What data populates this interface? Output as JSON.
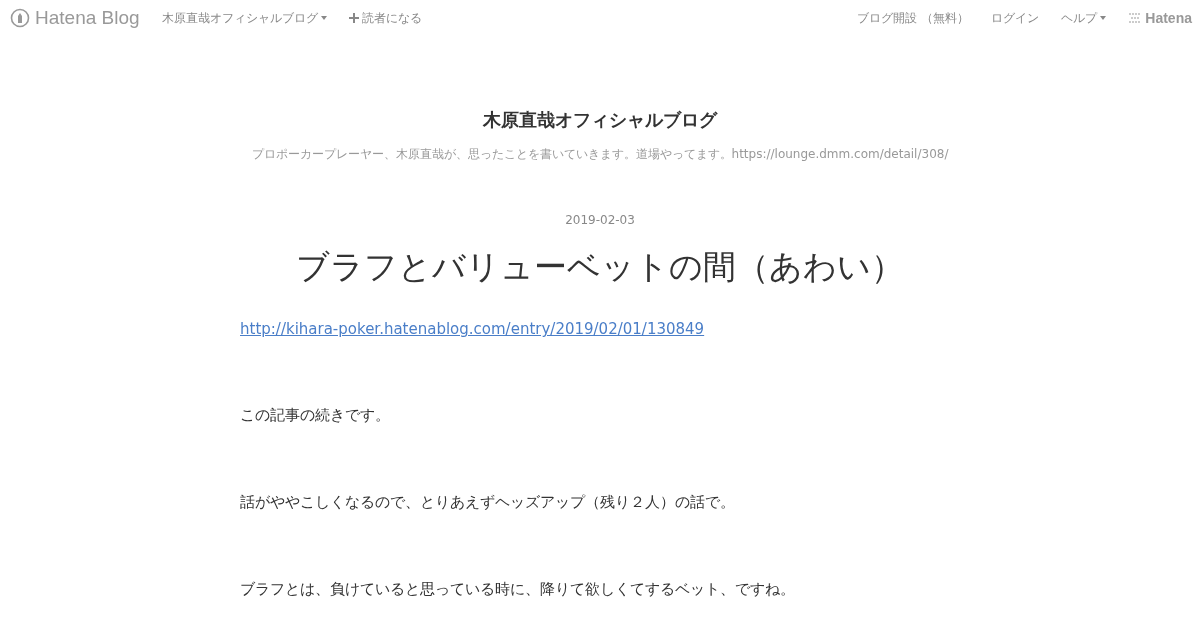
{
  "top_bar": {
    "logo": "Hatena Blog",
    "left_menu": [
      {
        "label": "木原直哉オフィシャルブログ",
        "kind": "dropdown"
      },
      {
        "label": "読者になる",
        "kind": "subscribe"
      }
    ],
    "right_menu": [
      {
        "label": "ブログ開設 （無料）",
        "kind": "link"
      },
      {
        "label": "ログイン",
        "kind": "link"
      },
      {
        "label": "ヘルプ",
        "kind": "dropdown"
      }
    ],
    "brand": "Hatena"
  },
  "blog": {
    "title": "木原直哉オフィシャルブログ",
    "description": "プロポーカープレーヤー、木原直哉が、思ったことを書いていきます。道場やってます。https://lounge.dmm.com/detail/308/"
  },
  "entry": {
    "date": "2019-02-03",
    "title": "ブラフとバリューベットの間（あわい）",
    "body": [
      {
        "kind": "link",
        "text": "http://kihara-poker.hatenablog.com/entry/2019/02/01/130849"
      },
      {
        "kind": "paragraph",
        "text": "この記事の続きです。"
      },
      {
        "kind": "paragraph",
        "text": "話がややこしくなるので、とりあえずヘッズアップ（残り２人）の話で。"
      },
      {
        "kind": "paragraph",
        "text": "ブラフとは、負けていると思っている時に、降りて欲しくてするベット、ですね。"
      }
    ]
  }
}
